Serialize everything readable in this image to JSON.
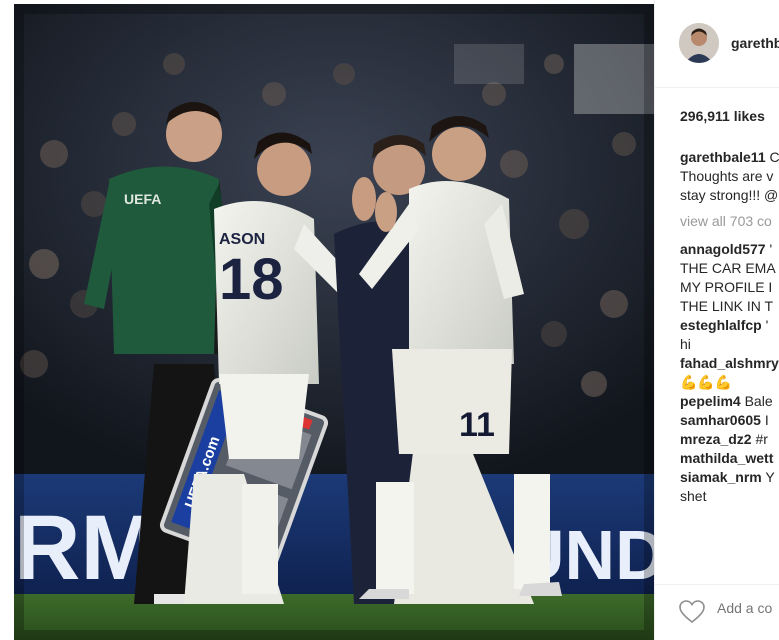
{
  "post": {
    "username": "garethb",
    "likes": "296,911 likes",
    "caption": {
      "user": "gareth bale11",
      "user_display": "garethbale11",
      "line1_rest": " C",
      "line2": "Thoughts are v",
      "line3": "stay strong!!! @"
    },
    "view_all": "view all 703 co",
    "comments": [
      {
        "user": "annagold577",
        "text": " '",
        "extra": [
          "THE CAR EMA",
          "MY PROFILE I",
          "THE LINK IN T"
        ]
      },
      {
        "user": "esteghlalfcp",
        "text": " '",
        "extra": [
          "hi"
        ]
      },
      {
        "user": "fahad_alshmry",
        "text": "",
        "extra": [
          "💪💪💪"
        ]
      },
      {
        "user": "pepelim4",
        "text": " Bale",
        "extra": []
      },
      {
        "user": "samhar0605",
        "text": " I",
        "extra": []
      },
      {
        "user": "mreza_dz2",
        "text": " #r",
        "extra": []
      },
      {
        "user": "mathilda_wett",
        "text": "",
        "extra": []
      },
      {
        "user": "siamak_nrm",
        "text": " Y",
        "extra": [
          "shet"
        ]
      }
    ],
    "add_comment_placeholder": "Add a co"
  },
  "photo": {
    "jersey_number_left": "18",
    "jersey_number_right": "11",
    "board_label": "UEFA.com",
    "ad_board_left": "RMO",
    "ad_board_right": "UND",
    "badge_text": "UEFA",
    "name_on_shirt": "ASON"
  }
}
